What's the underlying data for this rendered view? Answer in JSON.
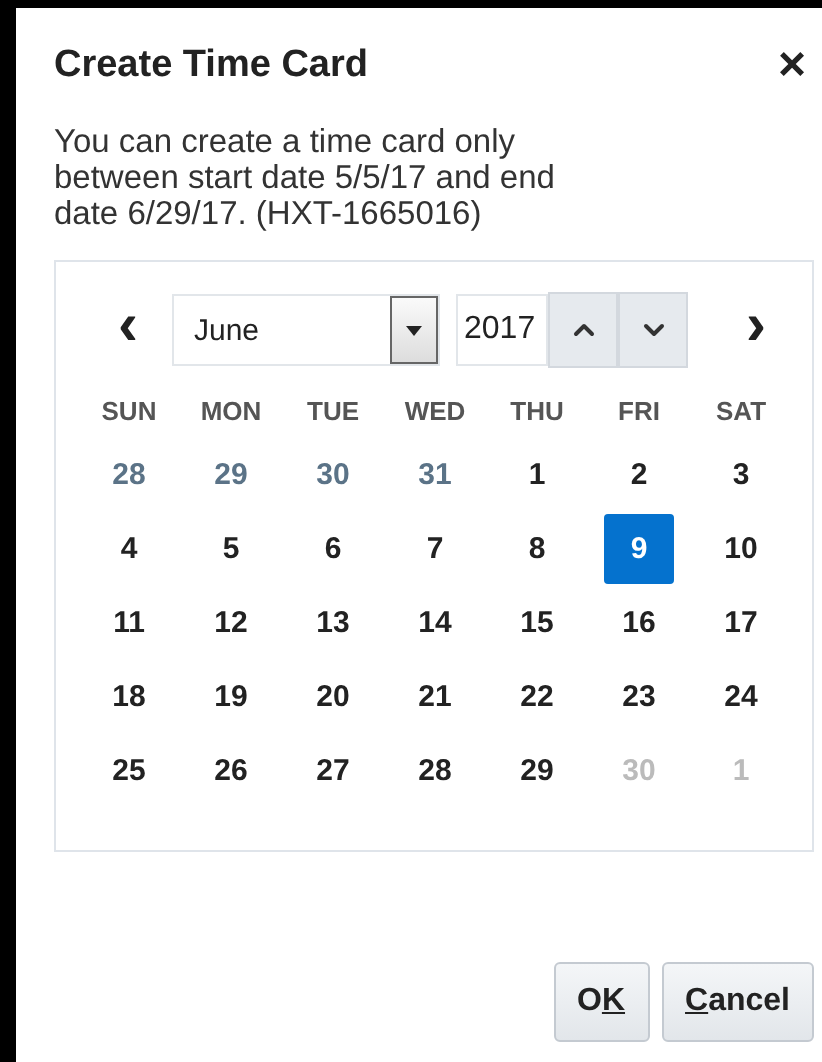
{
  "dialog": {
    "title": "Create Time Card",
    "close": "×"
  },
  "message": "You can create a time card only between start date 5/5/17 and end date 6/29/17. (HXT-1665016)",
  "calendar": {
    "prev": "‹",
    "next": "›",
    "month": "June",
    "year": "2017",
    "weekdays": [
      "SUN",
      "MON",
      "TUE",
      "WED",
      "THU",
      "FRI",
      "SAT"
    ],
    "weeks": [
      [
        {
          "day": "28",
          "kind": "other",
          "selected": false
        },
        {
          "day": "29",
          "kind": "other",
          "selected": false
        },
        {
          "day": "30",
          "kind": "other",
          "selected": false
        },
        {
          "day": "31",
          "kind": "other",
          "selected": false
        },
        {
          "day": "1",
          "kind": "normal",
          "selected": false
        },
        {
          "day": "2",
          "kind": "normal",
          "selected": false
        },
        {
          "day": "3",
          "kind": "normal",
          "selected": false
        }
      ],
      [
        {
          "day": "4",
          "kind": "normal",
          "selected": false
        },
        {
          "day": "5",
          "kind": "normal",
          "selected": false
        },
        {
          "day": "6",
          "kind": "normal",
          "selected": false
        },
        {
          "day": "7",
          "kind": "normal",
          "selected": false
        },
        {
          "day": "8",
          "kind": "normal",
          "selected": false
        },
        {
          "day": "9",
          "kind": "normal",
          "selected": true
        },
        {
          "day": "10",
          "kind": "normal",
          "selected": false
        }
      ],
      [
        {
          "day": "11",
          "kind": "normal",
          "selected": false
        },
        {
          "day": "12",
          "kind": "normal",
          "selected": false
        },
        {
          "day": "13",
          "kind": "normal",
          "selected": false
        },
        {
          "day": "14",
          "kind": "normal",
          "selected": false
        },
        {
          "day": "15",
          "kind": "normal",
          "selected": false
        },
        {
          "day": "16",
          "kind": "normal",
          "selected": false
        },
        {
          "day": "17",
          "kind": "normal",
          "selected": false
        }
      ],
      [
        {
          "day": "18",
          "kind": "normal",
          "selected": false
        },
        {
          "day": "19",
          "kind": "normal",
          "selected": false
        },
        {
          "day": "20",
          "kind": "normal",
          "selected": false
        },
        {
          "day": "21",
          "kind": "normal",
          "selected": false
        },
        {
          "day": "22",
          "kind": "normal",
          "selected": false
        },
        {
          "day": "23",
          "kind": "normal",
          "selected": false
        },
        {
          "day": "24",
          "kind": "normal",
          "selected": false
        }
      ],
      [
        {
          "day": "25",
          "kind": "normal",
          "selected": false
        },
        {
          "day": "26",
          "kind": "normal",
          "selected": false
        },
        {
          "day": "27",
          "kind": "normal",
          "selected": false
        },
        {
          "day": "28",
          "kind": "normal",
          "selected": false
        },
        {
          "day": "29",
          "kind": "normal",
          "selected": false
        },
        {
          "day": "30",
          "kind": "disabled",
          "selected": false
        },
        {
          "day": "1",
          "kind": "disabled",
          "selected": false
        }
      ]
    ]
  },
  "buttons": [
    {
      "before": "O",
      "access_key": "K"
    },
    {
      "access_key": "C",
      "after": "ancel"
    }
  ]
}
